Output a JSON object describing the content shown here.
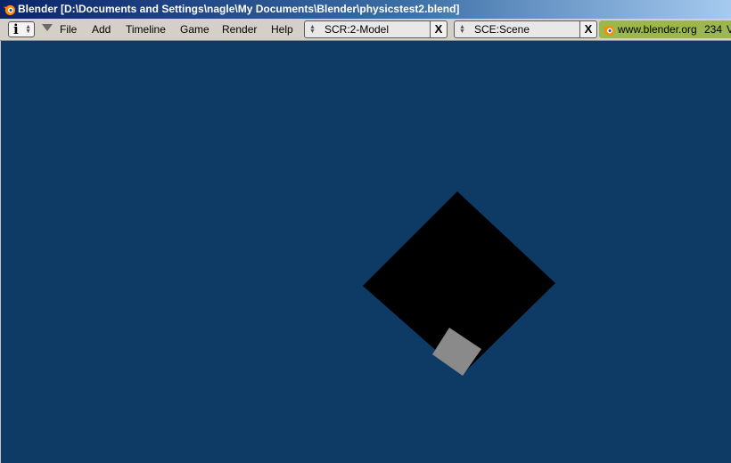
{
  "window": {
    "title": "Blender [D:\\Documents and Settings\\nagle\\My Documents\\Blender\\physicstest2.blend]"
  },
  "menubar": {
    "editor_icon": "info-icon",
    "menus": [
      {
        "label": "File"
      },
      {
        "label": "Add"
      },
      {
        "label": "Timeline"
      },
      {
        "label": "Game"
      },
      {
        "label": "Render"
      },
      {
        "label": "Help"
      }
    ],
    "screen_selector": {
      "value": "SCR:2-Model",
      "close_glyph": "X"
    },
    "scene_selector": {
      "value": "SCE:Scene",
      "close_glyph": "X"
    },
    "info": {
      "link_text": "www.blender.org",
      "version": "234",
      "overflow_glyph": "V"
    }
  },
  "viewport": {
    "background_color": "#0e3a66",
    "objects": [
      {
        "name": "large-black-square",
        "color": "#000000"
      },
      {
        "name": "small-gray-cube",
        "color": "#8a8a8a"
      }
    ]
  }
}
